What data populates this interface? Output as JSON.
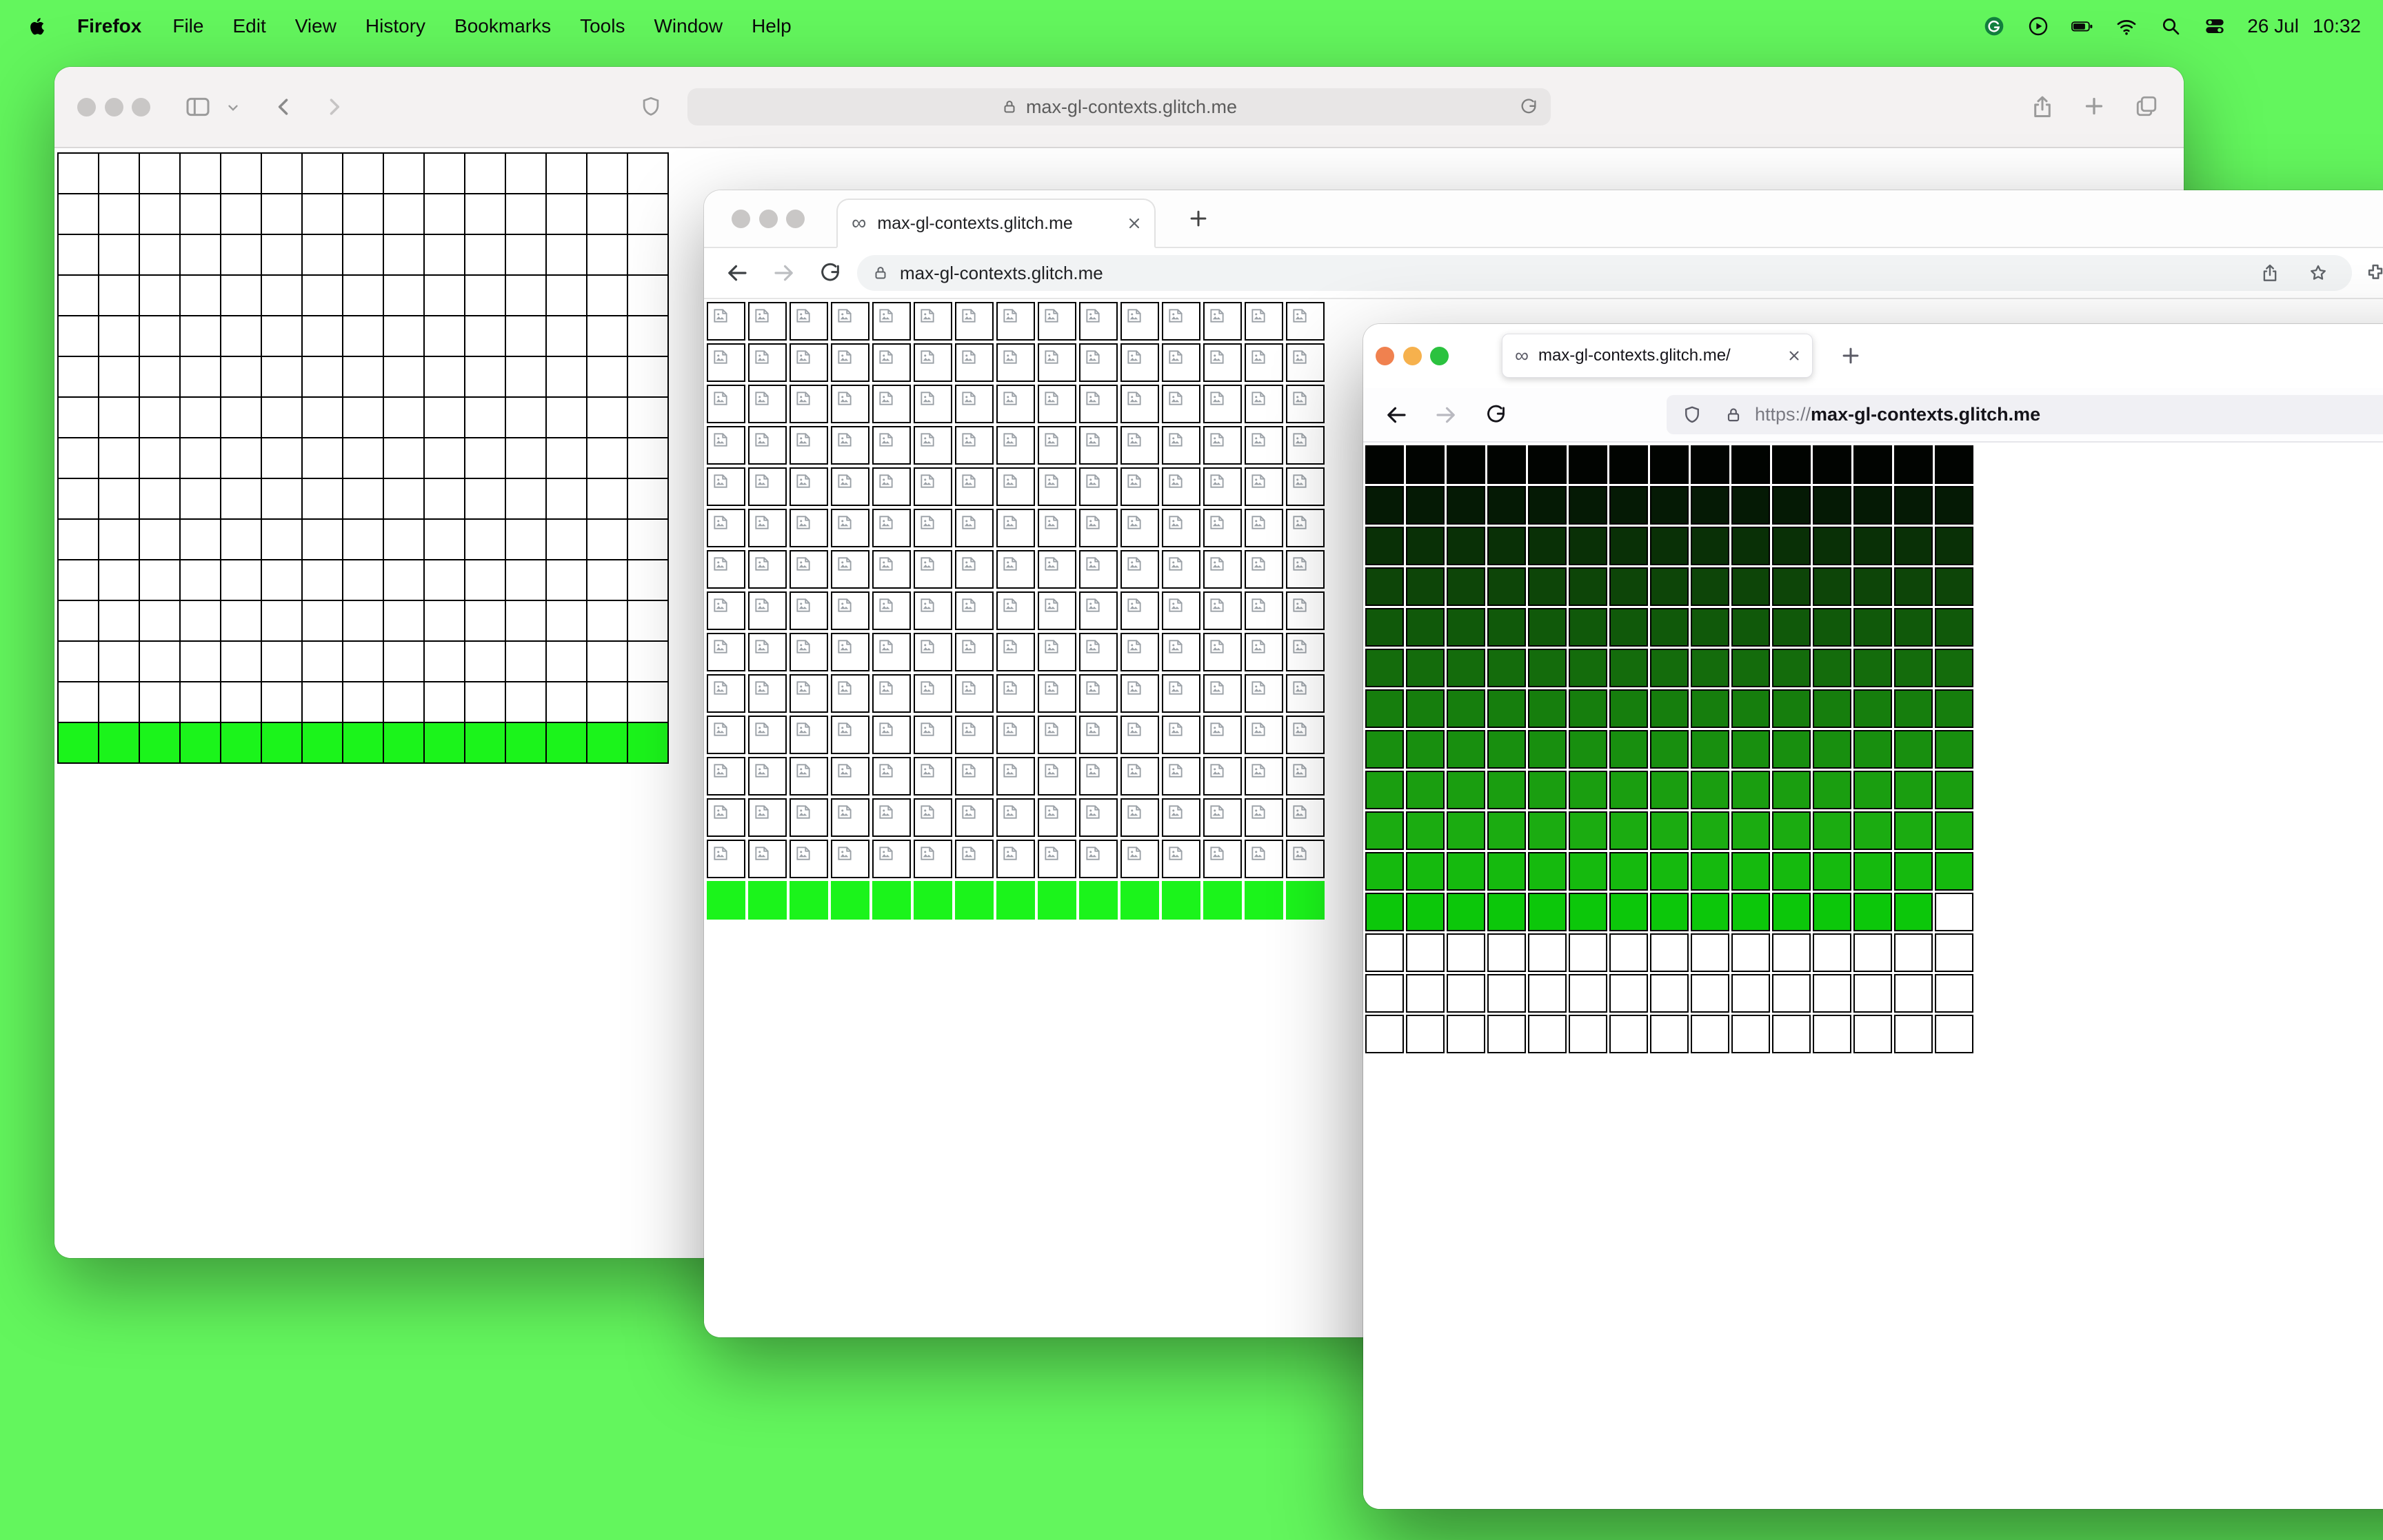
{
  "desktop": {
    "background_color": "#63f65d"
  },
  "menu_bar": {
    "app_name": "Firefox",
    "menus": [
      "File",
      "Edit",
      "View",
      "History",
      "Bookmarks",
      "Tools",
      "Window",
      "Help"
    ],
    "clock_date": "26 Jul",
    "clock_time": "10:32"
  },
  "safari_window": {
    "address": "max-gl-contexts.glitch.me",
    "grid": {
      "cols": 15,
      "white_rows": 14,
      "green_rows": 1,
      "green_color": "#1bf41b",
      "line_color": "#000000"
    }
  },
  "chrome_window": {
    "tab_favicon": "∞",
    "tab_title": "max-gl-contexts.glitch.me",
    "address": "max-gl-contexts.glitch.me",
    "grid": {
      "cols": 15,
      "broken_image_rows": 14,
      "green_rows": 1,
      "green_color": "#1bf41b"
    }
  },
  "firefox_window": {
    "tab_favicon": "∞",
    "tab_title": "max-gl-contexts.glitch.me/",
    "address_scheme": "https://",
    "address_host": "max-gl-contexts.glitch.me",
    "grid": {
      "cols": 15,
      "gradient_row_colors": [
        "#010401",
        "#051a05",
        "#093006",
        "#0d4508",
        "#10590a",
        "#146c0c",
        "#167e0d",
        "#188f0f",
        "#1a9e10",
        "#1bac11",
        "#15ba0e",
        "#0cc70a"
      ],
      "last_gradient_row_missing_last_cell": true,
      "empty_rows": 3
    }
  }
}
